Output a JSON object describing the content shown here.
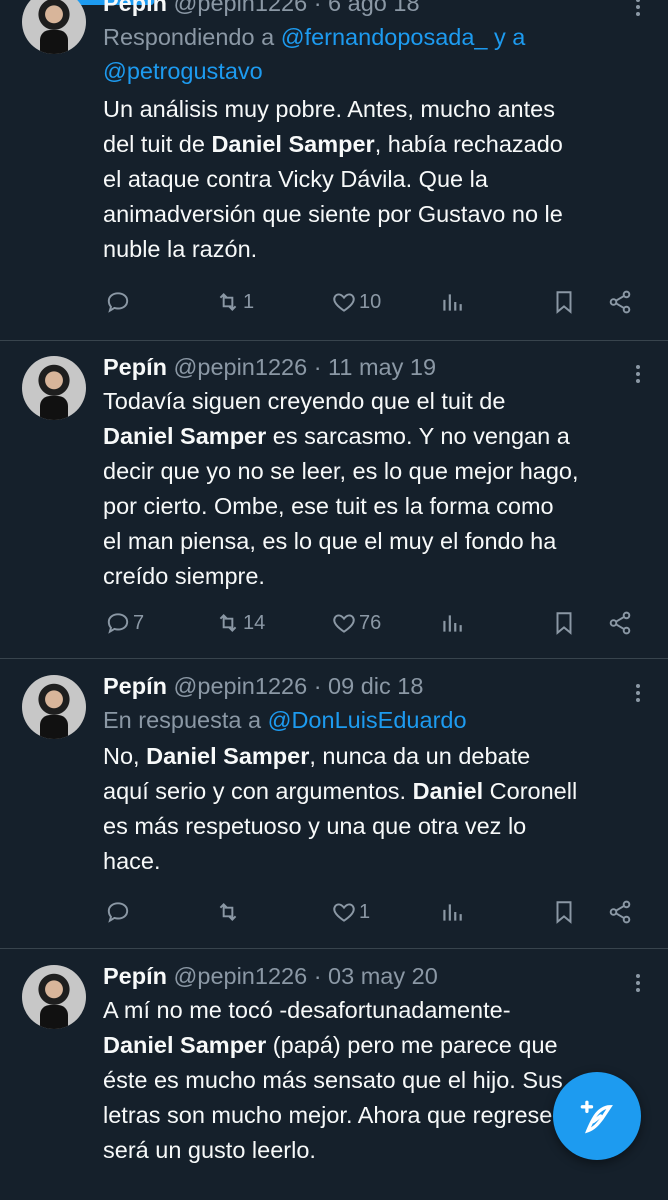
{
  "tweets": [
    {
      "author": "Pepín",
      "handle": "@pepin1226",
      "date": "6 ago 18",
      "reply_prefix": "Respondiendo a",
      "mentions": [
        "@fernandoposada_",
        "@petrogustavo"
      ],
      "mention_join": "y a",
      "text_lines": [
        "Un análisis muy pobre. Antes, mucho antes",
        [
          "del tuit de ",
          "Daniel Samper",
          ", había rechazado"
        ],
        "el ataque contra Vicky Dávila. Que la",
        "animadversión que siente por Gustavo no le",
        "nuble la razón."
      ],
      "replies": "",
      "retweets": "1",
      "likes": "10"
    },
    {
      "author": "Pepín",
      "handle": "@pepin1226",
      "date": "11 may 19",
      "text_lines": [
        "Todavía siguen creyendo que el tuit de",
        [
          "",
          "Daniel Samper",
          " es sarcasmo. Y no vengan a"
        ],
        "decir que yo no se leer, es lo que mejor hago,",
        "por cierto. Ombe, ese tuit es la forma como",
        "el man piensa, es lo que el muy el fondo ha",
        "creído siempre."
      ],
      "replies": "7",
      "retweets": "14",
      "likes": "76"
    },
    {
      "author": "Pepín",
      "handle": "@pepin1226",
      "date": "09 dic 18",
      "reply_prefix": "En respuesta a",
      "mentions": [
        "@DonLuisEduardo"
      ],
      "text_lines": [
        [
          "No, ",
          "Daniel Samper",
          ", nunca da un debate"
        ],
        [
          "aquí serio y con argumentos. ",
          "Daniel",
          " Coronell"
        ],
        "es más respetuoso y una que otra vez lo",
        "hace."
      ],
      "replies": "",
      "retweets": "",
      "likes": "1"
    },
    {
      "author": "Pepín",
      "handle": "@pepin1226",
      "date": "03 may 20",
      "text_lines": [
        "A mí no me tocó -desafortunadamente-",
        [
          "",
          "Daniel Samper",
          " (papá) pero me parece que"
        ],
        "éste es mucho más sensato que el hijo. Sus",
        "letras son mucho mejor. Ahora que regrese",
        "será un gusto leerlo."
      ]
    }
  ],
  "icons": {
    "reply": "reply-icon",
    "retweet": "retweet-icon",
    "like": "heart-icon",
    "views": "views-icon",
    "bookmark": "bookmark-icon",
    "share": "share-icon",
    "compose": "compose-icon"
  },
  "colors": {
    "background": "#15202b",
    "accent": "#1d9bf0",
    "muted": "#8b98a5",
    "text": "#f7f9f9",
    "divider": "#38444d"
  }
}
